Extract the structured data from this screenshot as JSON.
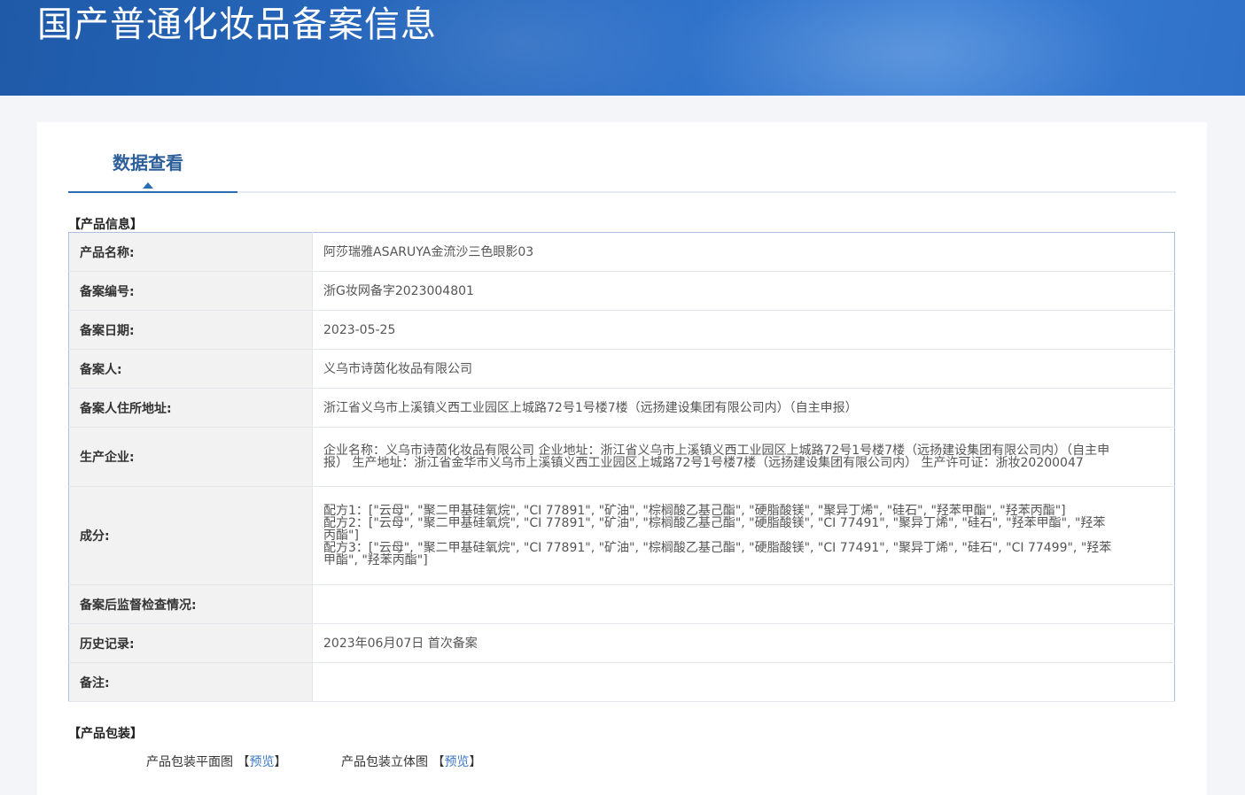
{
  "header": {
    "title": "国产普通化妆品备案信息"
  },
  "tab": {
    "label": "数据查看"
  },
  "product_info": {
    "heading": "【产品信息】",
    "rows": [
      {
        "label": "产品名称:",
        "value": "阿莎瑞雅ASARUYA金流沙三色眼影03"
      },
      {
        "label": "备案编号:",
        "value": "浙G妆网备字2023004801"
      },
      {
        "label": "备案日期:",
        "value": "2023-05-25"
      },
      {
        "label": "备案人:",
        "value": "义乌市诗茵化妆品有限公司"
      },
      {
        "label": "备案人住所地址:",
        "value": "浙江省义乌市上溪镇义西工业园区上城路72号1号楼7楼（远扬建设集团有限公司内）（自主申报）"
      },
      {
        "label": "生产企业:",
        "value": "企业名称：义乌市诗茵化妆品有限公司 企业地址：浙江省义乌市上溪镇义西工业园区上城路72号1号楼7楼（远扬建设集团有限公司内）（自主申报） 生产地址：浙江省金华市义乌市上溪镇义西工业园区上城路72号1号楼7楼（远扬建设集团有限公司内） 生产许可证：浙妆20200047"
      },
      {
        "label": "成分:",
        "value": "配方1：[\"云母\", \"聚二甲基硅氧烷\", \"CI 77891\", \"矿油\", \"棕榈酸乙基己酯\", \"硬脂酸镁\", \"聚异丁烯\", \"硅石\", \"羟苯甲酯\", \"羟苯丙酯\"]\n配方2：[\"云母\", \"聚二甲基硅氧烷\", \"CI 77891\", \"矿油\", \"棕榈酸乙基己酯\", \"硬脂酸镁\", \"CI 77491\", \"聚异丁烯\", \"硅石\", \"羟苯甲酯\", \"羟苯丙酯\"]\n配方3：[\"云母\", \"聚二甲基硅氧烷\", \"CI 77891\", \"矿油\", \"棕榈酸乙基己酯\", \"硬脂酸镁\", \"CI 77491\", \"聚异丁烯\", \"硅石\", \"CI 77499\", \"羟苯甲酯\", \"羟苯丙酯\"]"
      },
      {
        "label": "备案后监督检查情况:",
        "value": ""
      },
      {
        "label": "历史记录:",
        "value": "2023年06月07日 首次备案"
      },
      {
        "label": "备注:",
        "value": ""
      }
    ]
  },
  "packaging": {
    "heading": "【产品包装】",
    "flat_label": "产品包装平面图",
    "stereo_label": "产品包装立体图",
    "preview_link": "预览",
    "bracket_open": "【",
    "bracket_close": "】"
  },
  "colors": {
    "accent": "#2b6cb5",
    "banner": "#2a6cc4",
    "link": "#3c78c8"
  }
}
